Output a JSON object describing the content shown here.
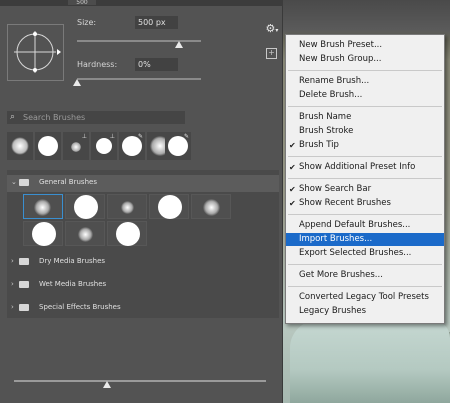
{
  "topbar": {
    "value": "500"
  },
  "brush_settings": {
    "size_label": "Size:",
    "size_value": "500 px",
    "size_fraction": 0.82,
    "hardness_label": "Hardness:",
    "hardness_value": "0%",
    "hardness_fraction": 0.0
  },
  "search": {
    "placeholder": "Search Brushes"
  },
  "groups": {
    "general": "General Brushes",
    "dry": "Dry Media Brushes",
    "wet": "Wet Media Brushes",
    "special": "Special Effects Brushes"
  },
  "menu": {
    "new_preset": "New Brush Preset...",
    "new_group": "New Brush Group...",
    "rename": "Rename Brush...",
    "delete": "Delete Brush...",
    "brush_name": "Brush Name",
    "brush_stroke": "Brush Stroke",
    "brush_tip": "Brush Tip",
    "show_additional": "Show Additional Preset Info",
    "show_search": "Show Search Bar",
    "show_recent": "Show Recent Brushes",
    "append_default": "Append Default Brushes...",
    "import": "Import Brushes...",
    "export": "Export Selected Brushes...",
    "get_more": "Get More Brushes...",
    "converted": "Converted Legacy Tool Presets",
    "legacy": "Legacy Brushes"
  },
  "icons": {
    "gear": "gear-icon",
    "search": "search-icon",
    "folder": "folder-icon",
    "chevron_down": "chevron-down-icon",
    "chevron_right": "chevron-right-icon",
    "check": "check-icon",
    "new_preset": "new-preset-icon",
    "cursor": "mouse-cursor-icon"
  },
  "colors": {
    "panel_bg": "#535353",
    "menu_bg": "#f0f0f0",
    "menu_highlight": "#1b6ac9",
    "selection_border": "#3a8fd0"
  }
}
